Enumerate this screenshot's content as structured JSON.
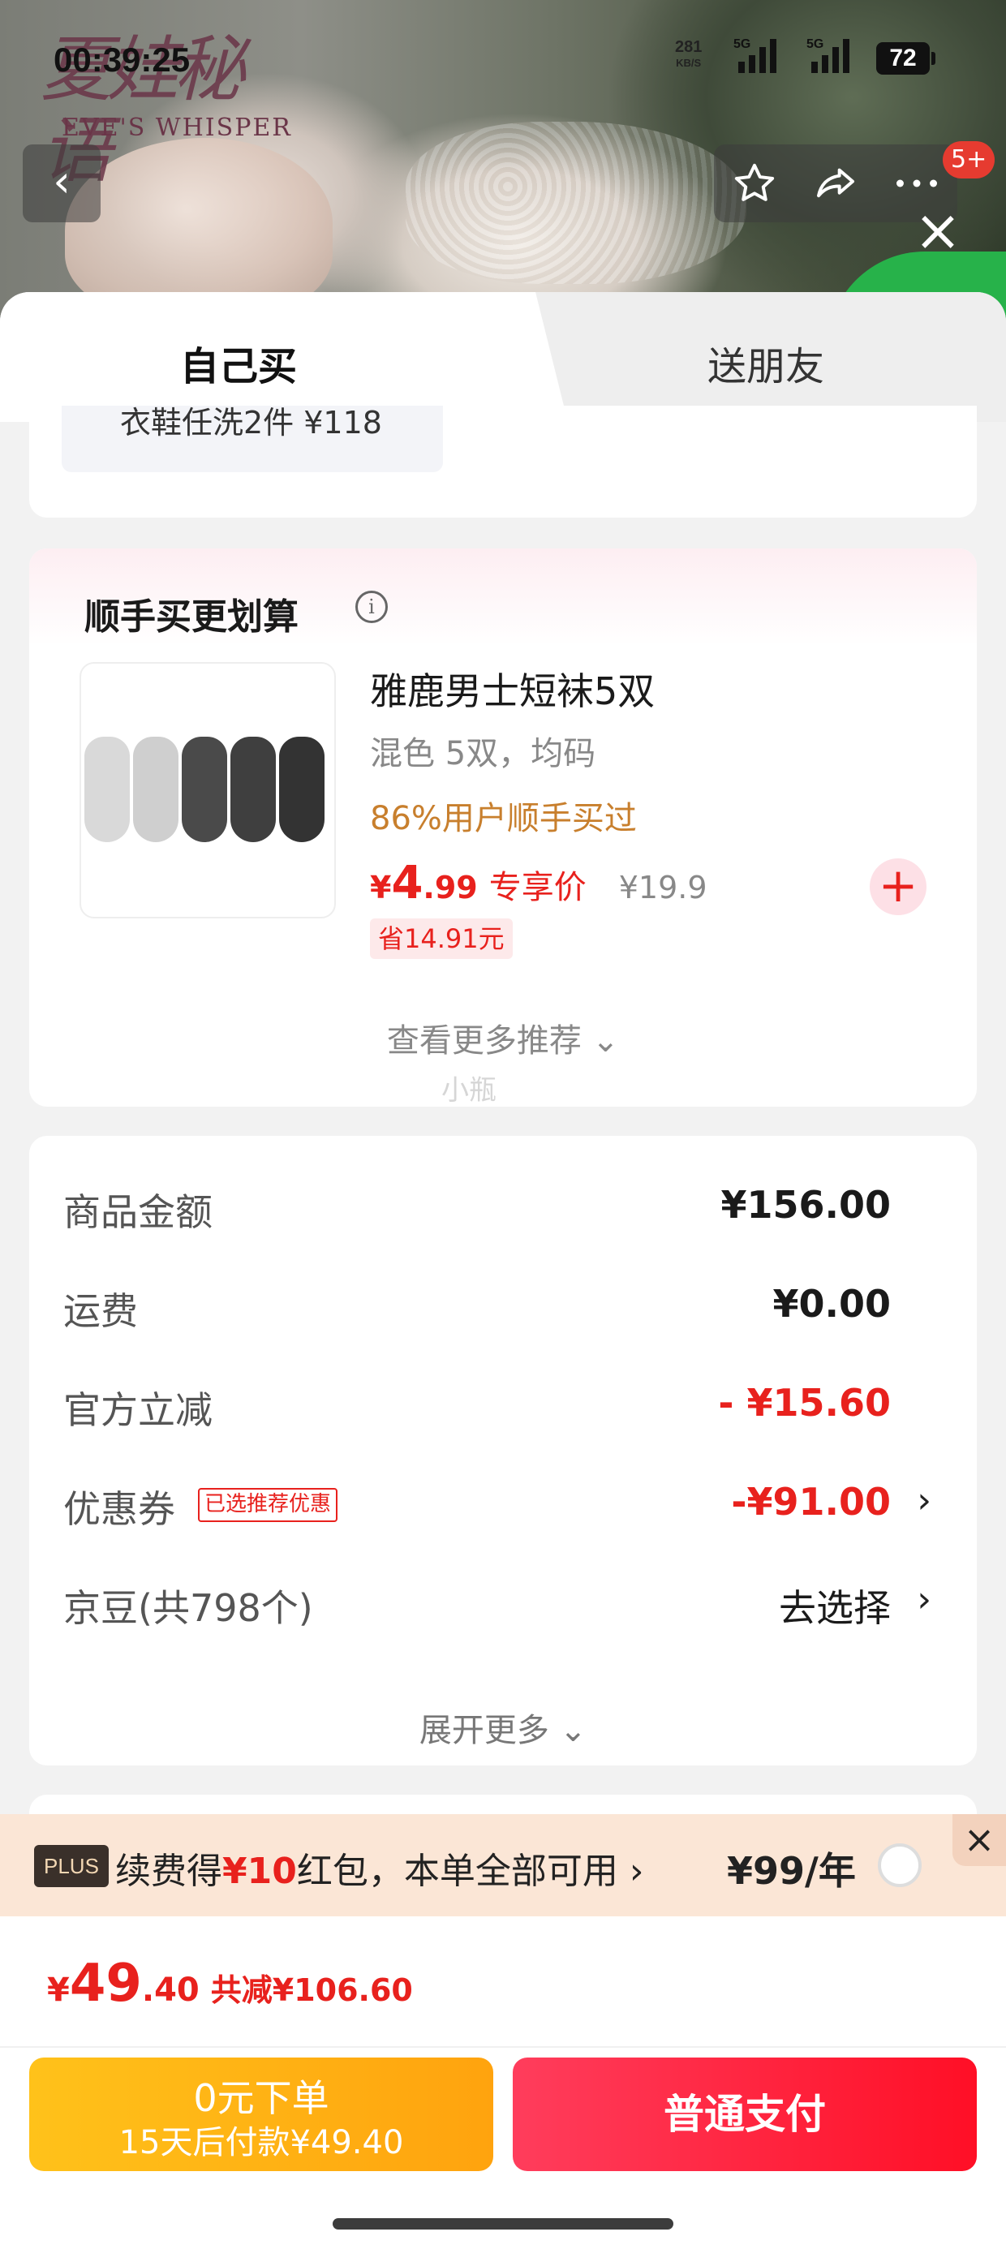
{
  "status_bar": {
    "time": "00:39:25",
    "net_speed": "281",
    "net_unit": "KB/S",
    "sim1": "5G",
    "sim2": "5G",
    "battery": "72"
  },
  "header": {
    "brand_cn": "夏娃秘语",
    "brand_en": "EVE'S WHISPER",
    "notification_badge": "5+"
  },
  "tabs": {
    "self": "自己买",
    "friend": "送朋友"
  },
  "prev_item": {
    "text": "衣鞋任洗2件 ¥118"
  },
  "recommend": {
    "title": "顺手买更划算",
    "product": {
      "name": "雅鹿男士短袜5双",
      "spec": "混色 5双，均码",
      "bought": "86%用户顺手买过",
      "price_symbol": "¥",
      "price_int": "4",
      "price_dec": ".99",
      "price_tag": "专享价",
      "original_price": "¥19.9",
      "save": "省14.91元"
    },
    "more": "查看更多推荐 ⌄",
    "watermark": "小瓶"
  },
  "summary": {
    "goods_label": "商品金额",
    "goods_value": "¥156.00",
    "shipping_label": "运费",
    "shipping_value": "¥0.00",
    "discount_label": "官方立减",
    "discount_value": "- ¥15.60",
    "coupon_label": "优惠券",
    "coupon_tag": "已选推荐优惠",
    "coupon_value": "-¥91.00",
    "beans_label": "京豆(共798个)",
    "beans_value": "去选择",
    "expand": "展开更多 ⌄"
  },
  "plus": {
    "logo": "PLUS",
    "text_pre": "续费得",
    "text_amount": "¥10",
    "text_post": "红包，本单全部可用 ›",
    "price": "¥99/年"
  },
  "footer": {
    "total_symbol": "¥",
    "total_int": "49",
    "total_dec": ".40",
    "total_save": "共减¥106.60",
    "pay_later_line1": "0元下单",
    "pay_later_line2": "15天后付款¥49.40",
    "pay_button": "普通支付"
  },
  "colors": {
    "accent_red": "#e8211d",
    "gold": "#c87f2d",
    "pay_yellow": "#ffb014",
    "pay_red": "#ff1f3d"
  }
}
